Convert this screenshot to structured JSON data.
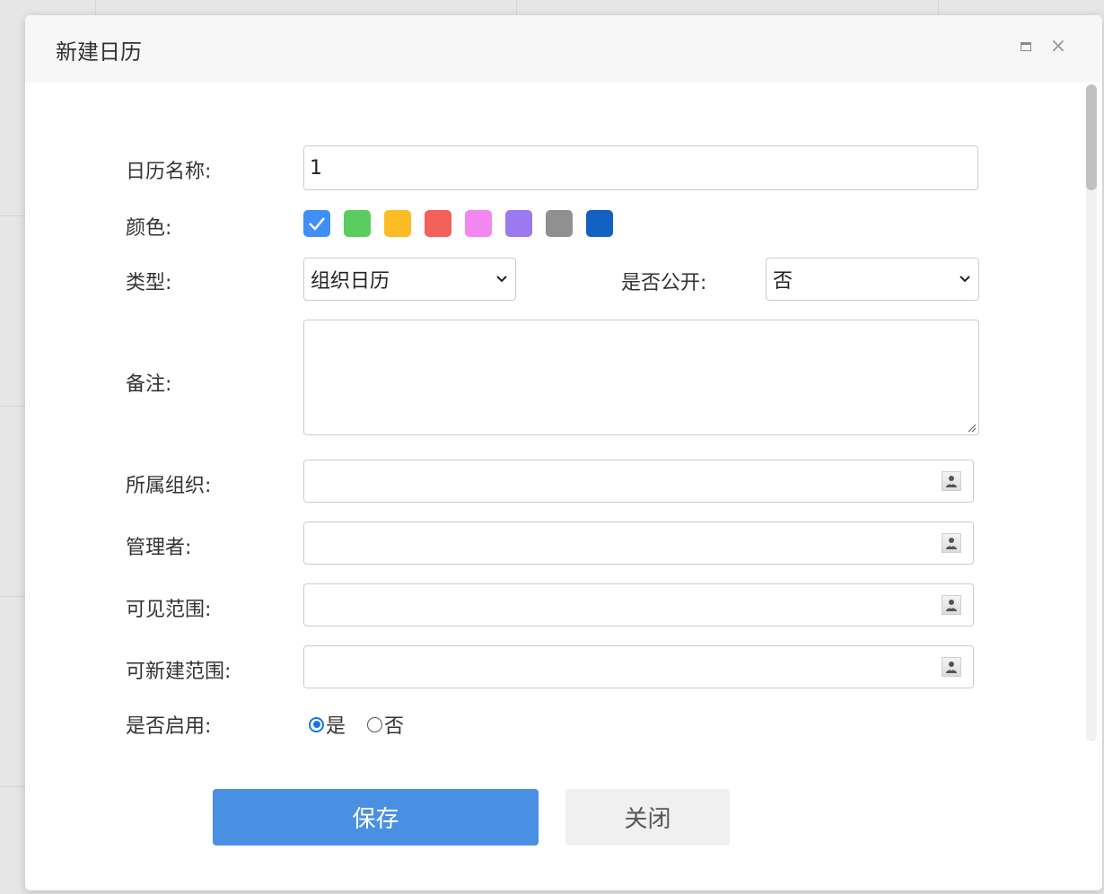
{
  "dialog": {
    "title": "新建日历"
  },
  "form": {
    "name": {
      "label": "日历名称:",
      "value": "1"
    },
    "color": {
      "label": "颜色:",
      "swatches": [
        {
          "color": "#3f8ff7",
          "selected": true
        },
        {
          "color": "#5bcc5f",
          "selected": false
        },
        {
          "color": "#fbbd23",
          "selected": false
        },
        {
          "color": "#f4605a",
          "selected": false
        },
        {
          "color": "#f287f0",
          "selected": false
        },
        {
          "color": "#9b79ef",
          "selected": false
        },
        {
          "color": "#909090",
          "selected": false
        },
        {
          "color": "#1361c0",
          "selected": false
        }
      ]
    },
    "type": {
      "label": "类型:",
      "value": "组织日历"
    },
    "public": {
      "label": "是否公开:",
      "value": "否"
    },
    "remark": {
      "label": "备注:",
      "value": ""
    },
    "org": {
      "label": "所属组织:",
      "value": ""
    },
    "manager": {
      "label": "管理者:",
      "value": ""
    },
    "visible_scope": {
      "label": "可见范围:",
      "value": ""
    },
    "create_scope": {
      "label": "可新建范围:",
      "value": ""
    },
    "enabled": {
      "label": "是否启用:",
      "options": [
        {
          "label": "是",
          "checked": true
        },
        {
          "label": "否",
          "checked": false
        }
      ]
    }
  },
  "buttons": {
    "save": "保存",
    "close": "关闭"
  },
  "icons": {
    "maximize": "maximize-icon",
    "close": "close-icon",
    "picker": "user-icon",
    "check": "check-icon",
    "chevron": "chevron-down-icon"
  }
}
